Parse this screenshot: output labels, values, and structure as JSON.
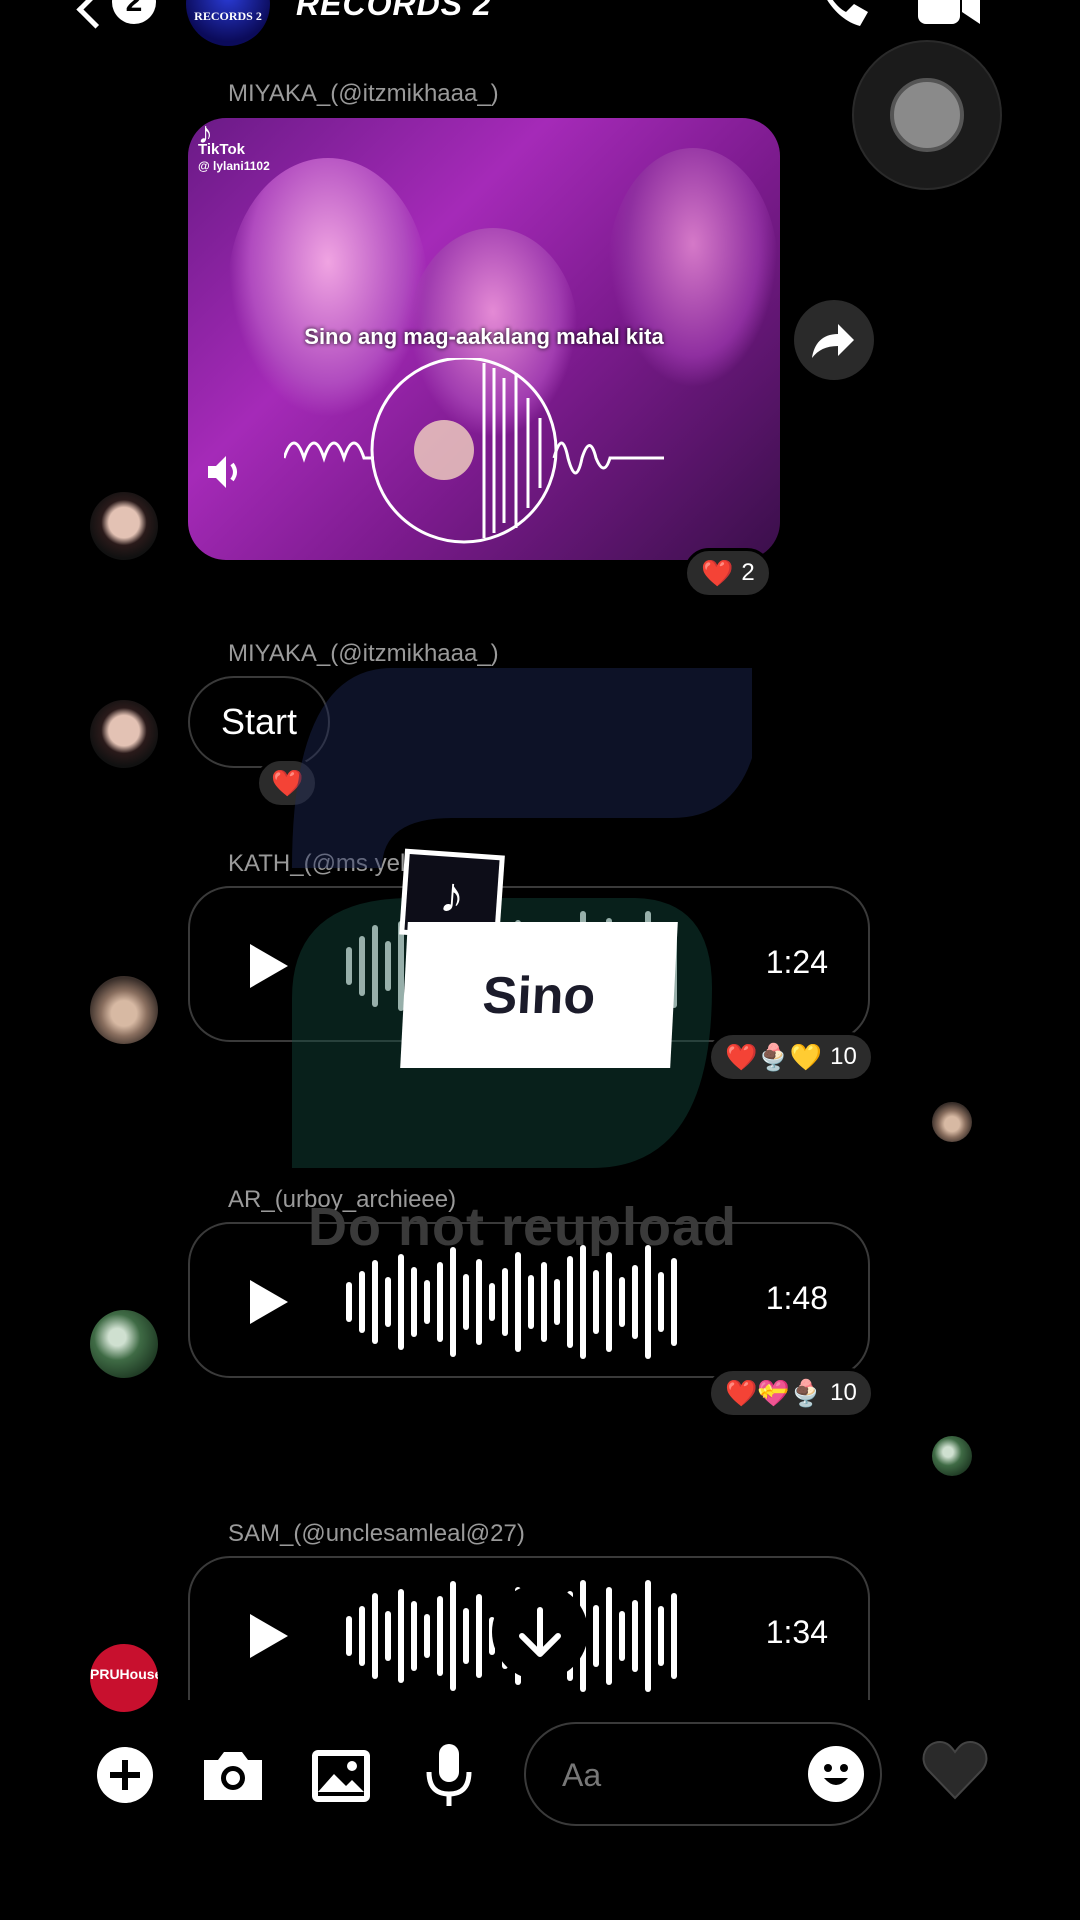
{
  "header": {
    "back_badge": "2",
    "group_avatar_text": "RECORDS 2",
    "title": "RECORDS 2"
  },
  "messages": [
    {
      "sender": "MIYAKA_(@itzmikhaaa_)",
      "type": "video",
      "tiktok_label": "TikTok",
      "tiktok_handle": "@ lylani1102",
      "lyric": "Sino ang mag-aakalang mahal kita",
      "reactions": "❤️",
      "reaction_count": "2"
    },
    {
      "sender": "MIYAKA_(@itzmikhaaa_)",
      "type": "text",
      "text": "Start",
      "reactions": "❤️"
    },
    {
      "sender": "KATH_(@ms.yel",
      "type": "voice",
      "duration": "1:24",
      "reactions": "❤️🍨💛",
      "reaction_count": "10"
    },
    {
      "sender": "AR_(urboy_archieee)",
      "type": "voice",
      "duration": "1:48",
      "reactions": "❤️💝🍨",
      "reaction_count": "10"
    },
    {
      "sender": "SAM_(@unclesamleal@27)",
      "type": "voice",
      "duration": "1:34",
      "avatar_text": "PRUHouse"
    }
  ],
  "overlay": {
    "watermark_text": "Do not reupload",
    "sticker_text": "Sino"
  },
  "composer": {
    "placeholder": "Aa"
  },
  "colors": {
    "background": "#000000",
    "bubble_border": "#3a3a3a",
    "reaction_pill": "#2b2b2b",
    "sender_text": "#9a9a9a"
  }
}
